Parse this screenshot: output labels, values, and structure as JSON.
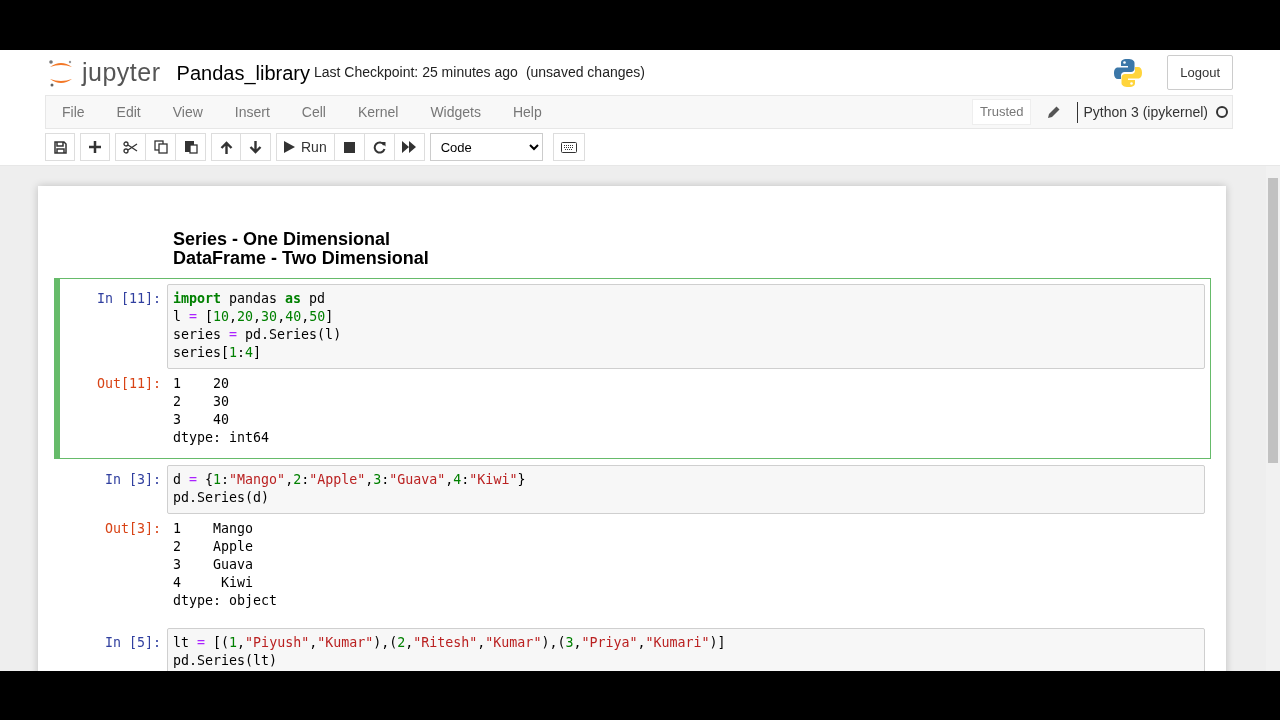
{
  "header": {
    "logo_text": "jupyter",
    "notebook_name": "Pandas_library",
    "checkpoint": "Last Checkpoint: 25 minutes ago",
    "unsaved": "(unsaved changes)",
    "logout": "Logout"
  },
  "menu": [
    "File",
    "Edit",
    "View",
    "Insert",
    "Cell",
    "Kernel",
    "Widgets",
    "Help"
  ],
  "status": {
    "trusted": "Trusted",
    "kernel_name": "Python 3 (ipykernel)",
    "kernel_busy": false
  },
  "toolbar": {
    "run_label": "Run",
    "cell_type": "Code"
  },
  "cells": [
    {
      "kind": "markdown",
      "selected": false,
      "lines": [
        "Series - One Dimensional",
        "DataFrame - Two Dimensional"
      ]
    },
    {
      "kind": "code",
      "selected": true,
      "prompt_in": "In [11]:",
      "input": [
        [
          {
            "t": "import",
            "kind": "kw"
          },
          {
            "t": " pandas ",
            "kind": "p"
          },
          {
            "t": "as",
            "kind": "kw"
          },
          {
            "t": " pd",
            "kind": "p"
          }
        ],
        [
          {
            "t": "l ",
            "kind": "p"
          },
          {
            "t": "=",
            "kind": "op"
          },
          {
            "t": " [",
            "kind": "p"
          },
          {
            "t": "10",
            "kind": "num"
          },
          {
            "t": ",",
            "kind": "p"
          },
          {
            "t": "20",
            "kind": "num"
          },
          {
            "t": ",",
            "kind": "p"
          },
          {
            "t": "30",
            "kind": "num"
          },
          {
            "t": ",",
            "kind": "p"
          },
          {
            "t": "40",
            "kind": "num"
          },
          {
            "t": ",",
            "kind": "p"
          },
          {
            "t": "50",
            "kind": "num"
          },
          {
            "t": "]",
            "kind": "p"
          }
        ],
        [
          {
            "t": "series ",
            "kind": "p"
          },
          {
            "t": "=",
            "kind": "op"
          },
          {
            "t": " pd.Series(l)",
            "kind": "p"
          }
        ],
        [
          {
            "t": "series[",
            "kind": "p"
          },
          {
            "t": "1",
            "kind": "num"
          },
          {
            "t": ":",
            "kind": "p"
          },
          {
            "t": "4",
            "kind": "num"
          },
          {
            "t": "]",
            "kind": "p"
          }
        ]
      ],
      "prompt_out": "Out[11]:",
      "output": [
        "1    20",
        "2    30",
        "3    40",
        "dtype: int64"
      ]
    },
    {
      "kind": "code",
      "selected": false,
      "prompt_in": "In [3]:",
      "input": [
        [
          {
            "t": "d ",
            "kind": "p"
          },
          {
            "t": "=",
            "kind": "op"
          },
          {
            "t": " {",
            "kind": "p"
          },
          {
            "t": "1",
            "kind": "num"
          },
          {
            "t": ":",
            "kind": "p"
          },
          {
            "t": "\"Mango\"",
            "kind": "str"
          },
          {
            "t": ",",
            "kind": "p"
          },
          {
            "t": "2",
            "kind": "num"
          },
          {
            "t": ":",
            "kind": "p"
          },
          {
            "t": "\"Apple\"",
            "kind": "str"
          },
          {
            "t": ",",
            "kind": "p"
          },
          {
            "t": "3",
            "kind": "num"
          },
          {
            "t": ":",
            "kind": "p"
          },
          {
            "t": "\"Guava\"",
            "kind": "str"
          },
          {
            "t": ",",
            "kind": "p"
          },
          {
            "t": "4",
            "kind": "num"
          },
          {
            "t": ":",
            "kind": "p"
          },
          {
            "t": "\"Kiwi\"",
            "kind": "str"
          },
          {
            "t": "}",
            "kind": "p"
          }
        ],
        [
          {
            "t": "pd.Series(d)",
            "kind": "p"
          }
        ]
      ],
      "prompt_out": "Out[3]:",
      "output": [
        "1    Mango",
        "2    Apple",
        "3    Guava",
        "4     Kiwi",
        "dtype: object"
      ]
    },
    {
      "kind": "code",
      "selected": false,
      "prompt_in": "In [5]:",
      "input": [
        [
          {
            "t": "lt ",
            "kind": "p"
          },
          {
            "t": "=",
            "kind": "op"
          },
          {
            "t": " [(",
            "kind": "p"
          },
          {
            "t": "1",
            "kind": "num"
          },
          {
            "t": ",",
            "kind": "p"
          },
          {
            "t": "\"Piyush\"",
            "kind": "str"
          },
          {
            "t": ",",
            "kind": "p"
          },
          {
            "t": "\"Kumar\"",
            "kind": "str"
          },
          {
            "t": "),(",
            "kind": "p"
          },
          {
            "t": "2",
            "kind": "num"
          },
          {
            "t": ",",
            "kind": "p"
          },
          {
            "t": "\"Ritesh\"",
            "kind": "str"
          },
          {
            "t": ",",
            "kind": "p"
          },
          {
            "t": "\"Kumar\"",
            "kind": "str"
          },
          {
            "t": "),(",
            "kind": "p"
          },
          {
            "t": "3",
            "kind": "num"
          },
          {
            "t": ",",
            "kind": "p"
          },
          {
            "t": "\"Priya\"",
            "kind": "str"
          },
          {
            "t": ",",
            "kind": "p"
          },
          {
            "t": "\"Kumari\"",
            "kind": "str"
          },
          {
            "t": ")]",
            "kind": "p"
          }
        ],
        [
          {
            "t": "pd.Series(lt)",
            "kind": "p"
          }
        ]
      ]
    }
  ]
}
